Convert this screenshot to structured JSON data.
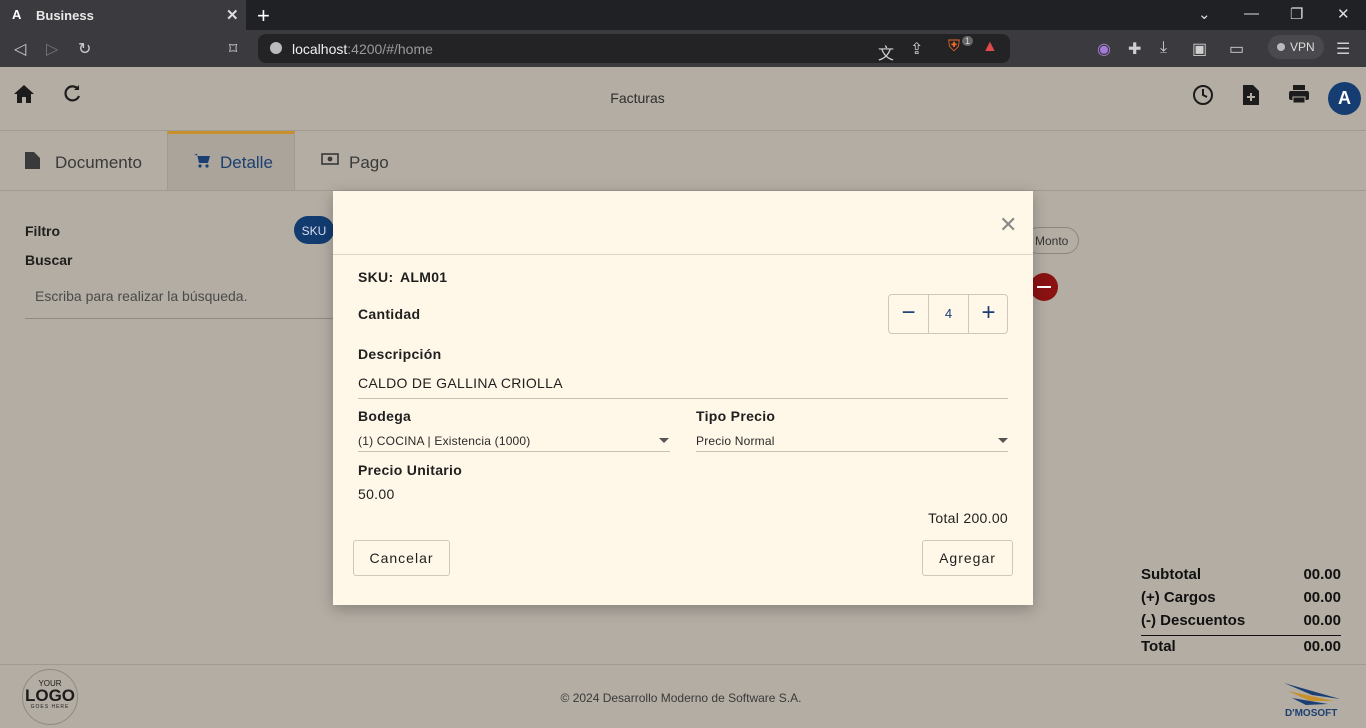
{
  "browser": {
    "tab_title": "Business",
    "url_host": "localhost",
    "url_rest": ":4200/#/home",
    "vpn_label": "VPN",
    "tab_logo": "A",
    "shield_badge": "1"
  },
  "header": {
    "title": "Facturas",
    "avatar_initial": "A"
  },
  "tabs": [
    {
      "label": "Documento",
      "icon": "file-icon"
    },
    {
      "label": "Detalle",
      "icon": "cart-icon"
    },
    {
      "label": "Pago",
      "icon": "money-icon"
    }
  ],
  "filter": {
    "filtro_label": "Filtro",
    "buscar_label": "Buscar",
    "search_placeholder": "Escriba para realizar la búsqueda.",
    "chip_sku": "SKU",
    "chip_monto": "Monto"
  },
  "totals": [
    {
      "label": "Subtotal",
      "value": "00.00"
    },
    {
      "label": "(+) Cargos",
      "value": "00.00"
    },
    {
      "label": "(-) Descuentos",
      "value": "00.00"
    },
    {
      "label": "Total",
      "value": "00.00"
    }
  ],
  "footer": {
    "copyright": "© 2024 Desarrollo Moderno de Software S.A.",
    "logo_your": "YOUR",
    "logo_main": "LOGO",
    "logo_sub": "GOES HERE",
    "brand": "D'MOSOFT"
  },
  "modal": {
    "sku_label": "SKU:",
    "sku_value": "ALM01",
    "cantidad_label": "Cantidad",
    "cantidad_value": "4",
    "descripcion_label": "Descripción",
    "descripcion_value": "CALDO DE GALLINA CRIOLLA",
    "bodega_label": "Bodega",
    "bodega_value": "(1) COCINA | Existencia (1000)",
    "tipo_precio_label": "Tipo Precio",
    "tipo_precio_value": "Precio Normal",
    "precio_label": "Precio Unitario",
    "precio_value": "50.00",
    "total_text": "Total 200.00",
    "cancel_label": "Cancelar",
    "add_label": "Agregar"
  },
  "colors": {
    "accent": "#1c3f73",
    "tab_indicator": "#c7922d",
    "modal_bg": "#fff7e8",
    "overlay_bg": "#b3ada3",
    "danger": "#8a1212"
  }
}
